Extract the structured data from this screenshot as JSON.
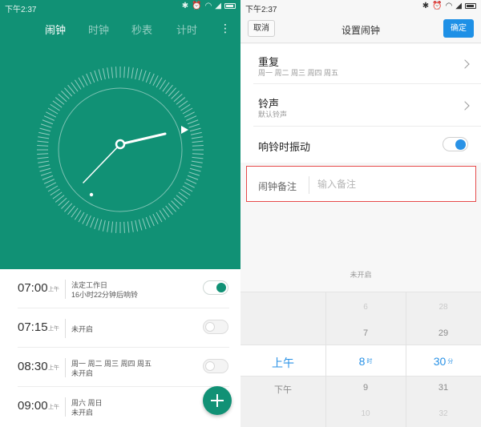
{
  "left_screen": {
    "status_bar": {
      "time": "下午2:37",
      "icons": [
        "bluetooth-icon",
        "alarm-icon",
        "wifi-icon",
        "signal-icon",
        "battery-icon"
      ]
    },
    "tabs": [
      {
        "label": "闹钟",
        "active": true
      },
      {
        "label": "时钟",
        "active": false
      },
      {
        "label": "秒表",
        "active": false
      },
      {
        "label": "计时",
        "active": false
      }
    ],
    "more_icon": "vertical-dots-icon",
    "alarms": [
      {
        "time": "07:00",
        "ampm": "上午",
        "line1": "法定工作日",
        "line2": "16小时22分钟后响铃",
        "enabled": true
      },
      {
        "time": "07:15",
        "ampm": "上午",
        "line1": "未开启",
        "line2": "",
        "enabled": false
      },
      {
        "time": "08:30",
        "ampm": "上午",
        "line1": "周一 周二 周三 周四 周五",
        "line2": "未开启",
        "enabled": false
      },
      {
        "time": "09:00",
        "ampm": "上午",
        "line1": "周六 周日",
        "line2": "未开启",
        "enabled": false
      }
    ],
    "fab_icon": "plus-icon",
    "colors": {
      "accent": "#119175"
    }
  },
  "right_screen": {
    "status_bar": {
      "time": "下午2:37",
      "icons": [
        "bluetooth-icon",
        "alarm-icon",
        "wifi-icon",
        "signal-icon",
        "battery-icon"
      ]
    },
    "topbar": {
      "cancel_label": "取消",
      "title": "设置闹钟",
      "ok_label": "确定"
    },
    "settings": {
      "repeat": {
        "title": "重复",
        "value": "周一 周二 周三 周四 周五"
      },
      "ringtone": {
        "title": "铃声",
        "value": "默认铃声"
      },
      "vibrate": {
        "title": "响铃时振动",
        "enabled": true
      }
    },
    "note": {
      "label": "闹钟备注",
      "placeholder": "输入备注",
      "value": ""
    },
    "status_text": "未开启",
    "picker": {
      "ampm": {
        "above": "",
        "selected": "上午",
        "below": "下午"
      },
      "hour": {
        "above2": "6",
        "above1": "7",
        "selected": "8",
        "unit": "时",
        "below1": "9",
        "below2": "10"
      },
      "minute": {
        "above2": "28",
        "above1": "29",
        "selected": "30",
        "unit": "分",
        "below1": "31",
        "below2": "32"
      }
    },
    "colors": {
      "accent": "#1e90e6",
      "highlight_border": "#e64a4a"
    }
  }
}
